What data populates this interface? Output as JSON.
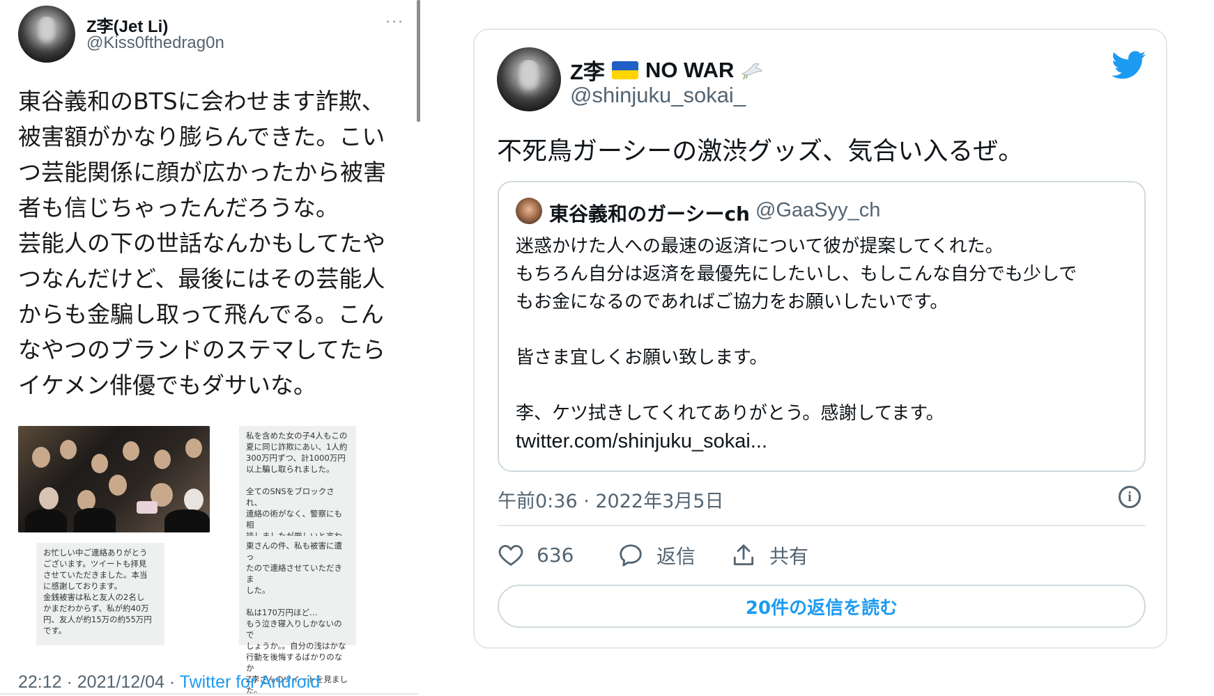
{
  "left_tweet": {
    "author_name": "Z李(Jet Li)",
    "author_handle": "@Kiss0fthedrag0n",
    "more_label": "···",
    "text": "東谷義和のBTSに会わせます詐欺、\n被害額がかなり膨らんできた。こい\nつ芸能関係に顔が広かったから被害\n者も信じちゃったんだろうな。\n芸能人の下の世話なんかもしてたや\nつなんだけど、最後にはその芸能人\nからも金騙し取って飛んでる。こん\nなやつのブランドのステマしてたら\nイケメン俳優でもダサいな。",
    "screenshot_1": "お忙しい中ご連絡ありがとう\nございます。ツイートも拝見\nさせていただきました。本当\nに感謝しております。\n金銭被害は私と友人の2名し\nかまだわからず、私が約40万\n円、友人が約15万の約55万円\nです。",
    "screenshot_2": "私を含めた女の子4人もこの\n夏に同じ詐欺にあい、1人約\n300万円ずつ、計1000万円\n以上騙し取られました。\n\n全てのSNSをブロックされ、\n連絡の術がなく、警察にも相\n談しましたが厳しいと言わ\nれ、泣き寝入りしないといけ",
    "screenshot_3": "東さんの件、私も被害に遭っ\nたので連絡させていただきま\nした。\n\n私は170万円ほど…\nもう泣き寝入りしかないので\nしょうか。。自分の浅はかな\n行動を後悔するばかりのなか\nZ李さんのツイートを見まし\nた。",
    "timestamp": "22:12 · 2021/12/04 · ",
    "source": "Twitter for Android"
  },
  "embed": {
    "author_name": "Z李",
    "name_suffix": "NO WAR",
    "author_handle": "@shinjuku_sokai_",
    "text": "不死鳥ガーシーの激渋グッズ、気合い入るぜ。",
    "quote": {
      "author_name": "東谷義和のガーシーch",
      "author_handle": "@GaaSyy_ch",
      "text": "迷惑かけた人への最速の返済について彼が提案してくれた。\nもちろん自分は返済を最優先にしたいし、もしこんな自分でも少しで\nもお金になるのであればご協力をお願いしたいです。\n\n皆さま宜しくお願い致します。\n\n李、ケツ拭きしてくれてありがとう。感謝してます。",
      "link": "twitter.com/shinjuku_sokai..."
    },
    "timestamp": "午前0:36 · 2022年3月5日",
    "info_icon": "i",
    "like_count": "636",
    "reply_label": "返信",
    "share_label": "共有",
    "read_replies_label": "20件の返信を読む",
    "colors": {
      "accent": "#1d9bf0",
      "muted": "#536471",
      "border": "#cfd9de"
    },
    "icons": [
      "twitter-bird-icon",
      "ukraine-flag-icon",
      "dove-icon",
      "heart-icon",
      "reply-bubble-icon",
      "share-icon",
      "info-icon"
    ]
  }
}
